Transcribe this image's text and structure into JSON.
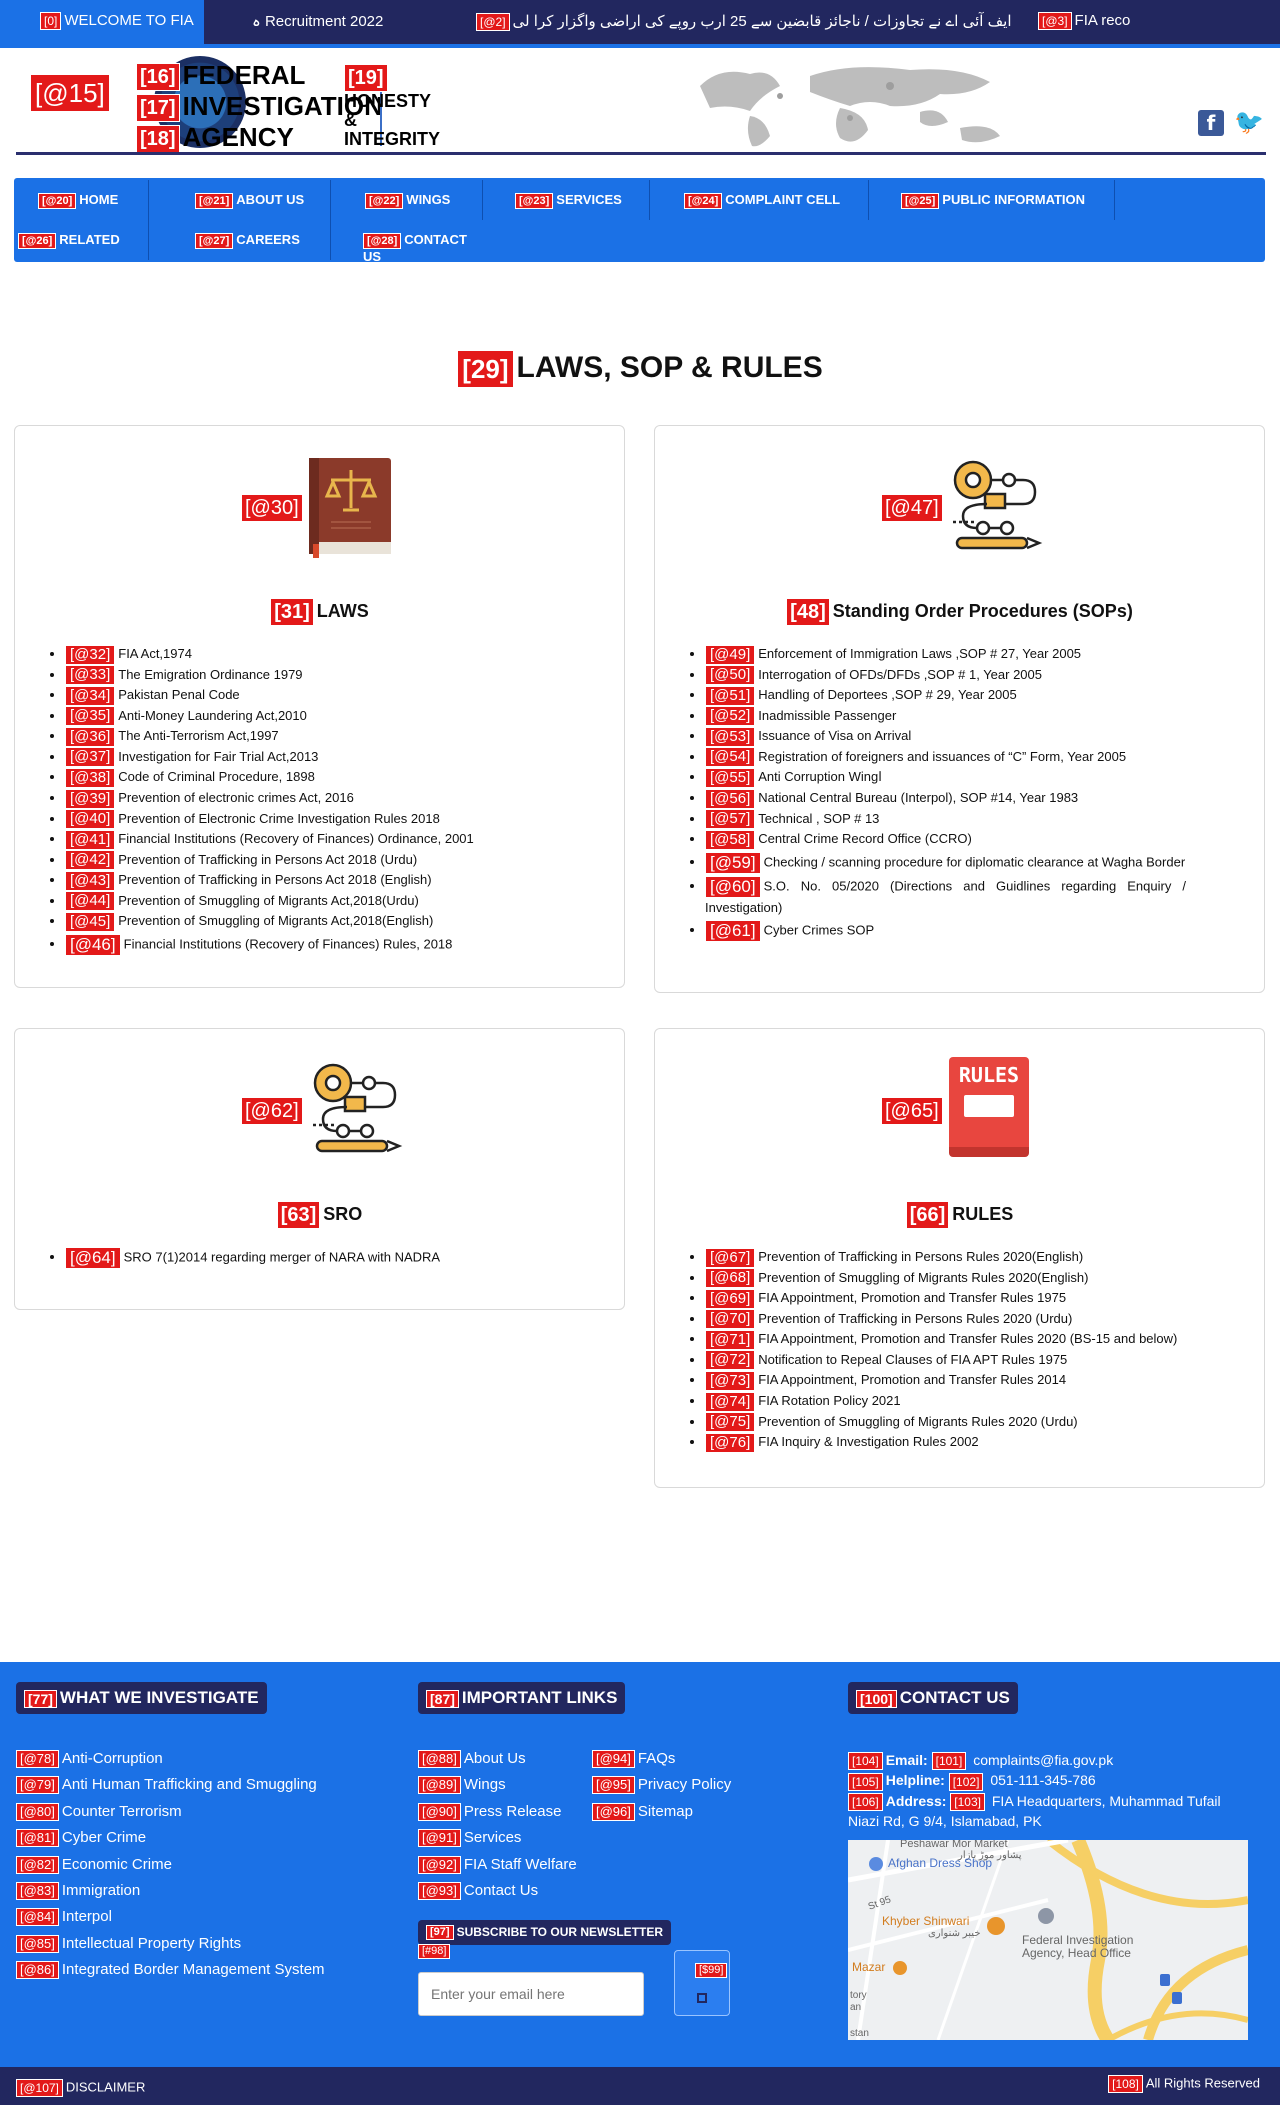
{
  "ticker": {
    "items": [
      {
        "tag": "[0]",
        "text": "WELCOME TO FIA"
      },
      {
        "tag": "",
        "text": "ہ Recruitment 2022"
      },
      {
        "tag": "[@2]",
        "text": "ایف آئی اے نے تجاوزات / ناجائز قابضین سے 25 ارب روپے کی اراضی واگزار کرا لی"
      },
      {
        "tag": "[@3]",
        "text": "FIA reco"
      }
    ]
  },
  "header": {
    "logo_tag": "[@15]",
    "agency": [
      {
        "tag": "[16]",
        "text": "FEDERAL"
      },
      {
        "tag": "[17]",
        "text": "INVESTIGATION"
      },
      {
        "tag": "[18]",
        "text": "AGENCY"
      }
    ],
    "motto_tag": "[19]",
    "motto": [
      "HONESTY",
      "&",
      "INTEGRITY"
    ],
    "social": {
      "facebook": "f",
      "twitter": "🐦"
    }
  },
  "nav": {
    "items": [
      {
        "tag": "[@20]",
        "label": "HOME"
      },
      {
        "tag": "[@21]",
        "label": "ABOUT US"
      },
      {
        "tag": "[@22]",
        "label": "WINGS"
      },
      {
        "tag": "[@23]",
        "label": "SERVICES"
      },
      {
        "tag": "[@24]",
        "label": "COMPLAINT CELL"
      },
      {
        "tag": "[@25]",
        "label": "PUBLIC INFORMATION"
      },
      {
        "tag": "[@26]",
        "label": "RELATED"
      },
      {
        "tag": "[@27]",
        "label": "CAREERS"
      },
      {
        "tag": "[@28]",
        "label": "CONTACT US"
      }
    ]
  },
  "page": {
    "title_tag": "[29]",
    "title": "LAWS, SOP & RULES"
  },
  "cards": {
    "laws": {
      "icon_tag": "[@30]",
      "icon": "law-book-icon",
      "title_tag": "[31]",
      "title": "LAWS",
      "items": [
        {
          "tag": "[@32]",
          "text": "FIA Act,1974"
        },
        {
          "tag": "[@33]",
          "text": "The Emigration Ordinance 1979"
        },
        {
          "tag": "[@34]",
          "text": "Pakistan Penal Code"
        },
        {
          "tag": "[@35]",
          "text": "Anti-Money Laundering Act,2010"
        },
        {
          "tag": "[@36]",
          "text": "The Anti-Terrorism Act,1997"
        },
        {
          "tag": "[@37]",
          "text": "Investigation for Fair Trial Act,2013"
        },
        {
          "tag": "[@38]",
          "text": "Code of Criminal Procedure, 1898"
        },
        {
          "tag": "[@39]",
          "text": "Prevention of electronic crimes Act, 2016"
        },
        {
          "tag": "[@40]",
          "text": "Prevention of Electronic Crime Investigation Rules 2018"
        },
        {
          "tag": "[@41]",
          "text": "Financial Institutions (Recovery of Finances) Ordinance, 2001"
        },
        {
          "tag": "[@42]",
          "text": "Prevention of Trafficking in Persons Act 2018 (Urdu)"
        },
        {
          "tag": "[@43]",
          "text": "Prevention of Trafficking in Persons Act 2018 (English)"
        },
        {
          "tag": "[@44]",
          "text": "Prevention of Smuggling of Migrants Act,2018(Urdu)"
        },
        {
          "tag": "[@45]",
          "text": "Prevention of Smuggling of Migrants Act,2018(English)"
        },
        {
          "tag": "[@46]",
          "text": "Financial Institutions (Recovery of Finances) Rules, 2018"
        }
      ]
    },
    "sops": {
      "icon_tag": "[@47]",
      "icon": "process-gear-icon",
      "title_tag": "[48]",
      "title": "Standing Order Procedures (SOPs)",
      "items": [
        {
          "tag": "[@49]",
          "text": "Enforcement of Immigration Laws ,SOP # 27, Year 2005"
        },
        {
          "tag": "[@50]",
          "text": "Interrogation of OFDs/DFDs ,SOP # 1, Year 2005"
        },
        {
          "tag": "[@51]",
          "text": "Handling of Deportees ,SOP # 29, Year 2005"
        },
        {
          "tag": "[@52]",
          "text": "Inadmissible Passenger"
        },
        {
          "tag": "[@53]",
          "text": "Issuance of Visa on Arrival"
        },
        {
          "tag": "[@54]",
          "text": "Registration of foreigners and issuances of “C” Form, Year 2005"
        },
        {
          "tag": "[@55]",
          "text": "Anti Corruption Wingا"
        },
        {
          "tag": "[@56]",
          "text": "National Central Bureau (Interpol), SOP #14, Year 1983"
        },
        {
          "tag": "[@57]",
          "text": "Technical , SOP # 13"
        },
        {
          "tag": "[@58]",
          "text": "Central Crime Record Office (CCRO)"
        },
        {
          "tag": "[@59]",
          "text": "Checking / scanning procedure for diplomatic clearance at Wagha Border"
        },
        {
          "tag": "[@60]",
          "text": "S.O. No. 05/2020 (Directions and Guidlines regarding Enquiry / Investigation)"
        },
        {
          "tag": "[@61]",
          "text": "Cyber Crimes SOP"
        }
      ]
    },
    "sro": {
      "icon_tag": "[@62]",
      "icon": "process-gear-icon",
      "title_tag": "[63]",
      "title": "SRO",
      "items": [
        {
          "tag": "[@64]",
          "text": "SRO 7(1)2014 regarding merger of NARA with NADRA"
        }
      ]
    },
    "rules": {
      "icon_tag": "[@65]",
      "icon": "rules-book-icon",
      "icon_text": "RULES",
      "title_tag": "[66]",
      "title": "RULES",
      "items": [
        {
          "tag": "[@67]",
          "text": "Prevention of Trafficking in Persons Rules 2020(English)"
        },
        {
          "tag": "[@68]",
          "text": "Prevention of Smuggling of Migrants Rules 2020(English)"
        },
        {
          "tag": "[@69]",
          "text": "FIA Appointment, Promotion and Transfer Rules 1975"
        },
        {
          "tag": "[@70]",
          "text": "Prevention of Trafficking in Persons Rules 2020 (Urdu)"
        },
        {
          "tag": "[@71]",
          "text": "FIA Appointment, Promotion and Transfer Rules 2020 (BS-15 and below)"
        },
        {
          "tag": "[@72]",
          "text": "Notification to Repeal Clauses of FIA APT Rules 1975"
        },
        {
          "tag": "[@73]",
          "text": "FIA Appointment, Promotion and Transfer Rules 2014"
        },
        {
          "tag": "[@74]",
          "text": "FIA Rotation Policy 2021"
        },
        {
          "tag": "[@75]",
          "text": "Prevention of Smuggling of Migrants Rules 2020 (Urdu)"
        },
        {
          "tag": "[@76]",
          "text": "FIA Inquiry & Investigation Rules 2002"
        }
      ]
    }
  },
  "footer": {
    "investigate": {
      "head_tag": "[77]",
      "head": "WHAT WE INVESTIGATE",
      "items": [
        {
          "tag": "[@78]",
          "text": "Anti-Corruption"
        },
        {
          "tag": "[@79]",
          "text": "Anti Human Trafficking and Smuggling"
        },
        {
          "tag": "[@80]",
          "text": "Counter Terrorism"
        },
        {
          "tag": "[@81]",
          "text": "Cyber Crime"
        },
        {
          "tag": "[@82]",
          "text": "Economic Crime"
        },
        {
          "tag": "[@83]",
          "text": "Immigration"
        },
        {
          "tag": "[@84]",
          "text": "Interpol"
        },
        {
          "tag": "[@85]",
          "text": "Intellectual Property Rights"
        },
        {
          "tag": "[@86]",
          "text": "Integrated Border Management System"
        }
      ]
    },
    "links": {
      "head_tag": "[87]",
      "head": "IMPORTANT LINKS",
      "col1": [
        {
          "tag": "[@88]",
          "text": "About Us"
        },
        {
          "tag": "[@89]",
          "text": "Wings"
        },
        {
          "tag": "[@90]",
          "text": "Press Release"
        },
        {
          "tag": "[@91]",
          "text": "Services"
        },
        {
          "tag": "[@92]",
          "text": "FIA Staff Welfare"
        },
        {
          "tag": "[@93]",
          "text": "Contact Us"
        }
      ],
      "col2": [
        {
          "tag": "[@94]",
          "text": "FAQs"
        },
        {
          "tag": "[@95]",
          "text": "Privacy Policy"
        },
        {
          "tag": "[@96]",
          "text": "Sitemap"
        }
      ]
    },
    "newsletter": {
      "head_tag": "[97]",
      "head": "SUBSCRIBE TO OUR NEWSLETTER",
      "input_tag": "[#98]",
      "placeholder": "Enter your email here",
      "button_tag": "[$99]"
    },
    "contact": {
      "head_tag": "[100]",
      "head": "CONTACT US",
      "email_tag": "[104]",
      "email_label": "Email:",
      "email_val_tag": "[101]",
      "email": "complaints@fia.gov.pk",
      "helpline_tag": "[105]",
      "helpline_label": "Helpline:",
      "helpline_val_tag": "[102]",
      "helpline": "051-111-345-786",
      "address_tag": "[106]",
      "address_label": "Address:",
      "address_val_tag": "[103]",
      "address": "FIA Headquarters, Muhammad Tufail Niazi Rd, G 9/4, Islamabad, PK"
    },
    "map": {
      "labels": [
        "Peshawar Mor Market",
        "پشاور موڑ بازار",
        "Afghan Dress Shop",
        "St 95",
        "Khyber Shinwari",
        "خیبر شنواری",
        "Federal Investigation Agency, Head Office",
        "Mazar",
        "tory",
        "an",
        "stan"
      ]
    }
  },
  "bottom": {
    "disclaimer_tag": "[@107]",
    "disclaimer": "DISCLAIMER",
    "rights_tag": "[108]",
    "rights": "All Rights Reserved"
  }
}
